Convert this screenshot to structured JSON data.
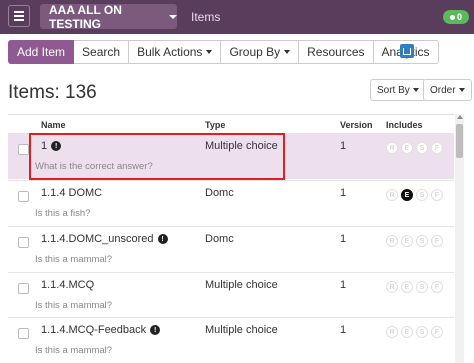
{
  "topbar": {
    "program_label": "AAA ALL ON TESTING",
    "breadcrumb": "Items",
    "notification_count": "0",
    "background": "#5a3d5c"
  },
  "toolbar": {
    "add_item": "Add Item",
    "search": "Search",
    "bulk_actions": "Bulk Actions",
    "group_by": "Group By",
    "resources": "Resources",
    "analytics": "Analytics"
  },
  "header": {
    "title": "Items: 136",
    "sort_by": "Sort By",
    "order": "Order"
  },
  "table": {
    "columns": {
      "name": "Name",
      "type": "Type",
      "version": "Version",
      "includes": "Includes"
    },
    "include_letters": [
      "R",
      "E",
      "S",
      "F"
    ],
    "rows": [
      {
        "name": "1",
        "info": true,
        "question": "What is the correct answer?",
        "type": "Multiple choice",
        "version": "1",
        "includes_on": []
      },
      {
        "name": "1.1.4 DOMC",
        "info": false,
        "question": "Is this a fish?",
        "type": "Domc",
        "version": "1",
        "includes_on": [
          "E"
        ]
      },
      {
        "name": "1.1.4.DOMC_unscored",
        "info": true,
        "question": "Is this a mammal?",
        "type": "Domc",
        "version": "1",
        "includes_on": []
      },
      {
        "name": "1.1.4.MCQ",
        "info": false,
        "question": "Is this a mammal?",
        "type": "Multiple choice",
        "version": "1",
        "includes_on": []
      },
      {
        "name": "1.1.4.MCQ-Feedback",
        "info": true,
        "question": "Is this a mammal?",
        "type": "Multiple choice",
        "version": "1",
        "includes_on": []
      }
    ]
  },
  "colors": {
    "accent": "#8e5a91",
    "selected_row": "#eedfee",
    "highlight_box": "#e02020",
    "notification": "#5cb85c"
  }
}
